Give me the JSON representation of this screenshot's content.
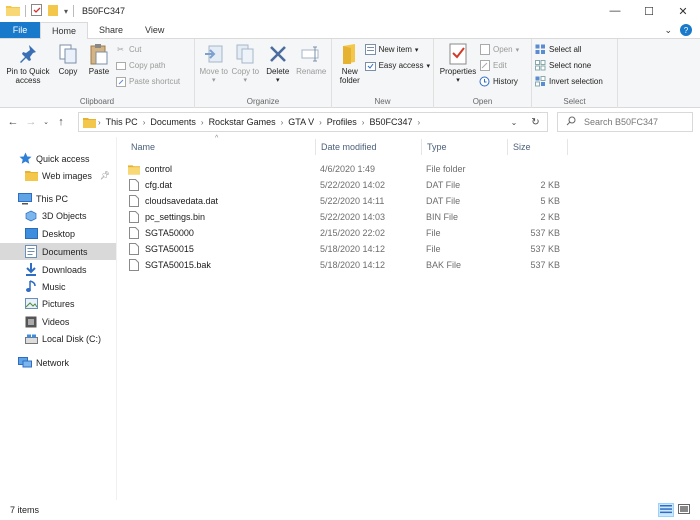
{
  "window": {
    "title": "B50FC347",
    "controls": {
      "minimize": "—",
      "maximize": "☐",
      "close": "✕"
    }
  },
  "tabs": [
    {
      "label": "File"
    },
    {
      "label": "Home"
    },
    {
      "label": "Share"
    },
    {
      "label": "View"
    }
  ],
  "ribbon": {
    "clipboard": {
      "label": "Clipboard",
      "pin_to_quick_access": "Pin to Quick access",
      "copy": "Copy",
      "paste": "Paste",
      "cut": "Cut",
      "copy_path": "Copy path",
      "paste_shortcut": "Paste shortcut"
    },
    "organize": {
      "label": "Organize",
      "move_to": "Move to",
      "copy_to": "Copy to",
      "delete": "Delete",
      "rename": "Rename"
    },
    "new": {
      "label": "New",
      "new_folder": "New folder",
      "new_item": "New item",
      "easy_access": "Easy access"
    },
    "open": {
      "label": "Open",
      "properties": "Properties",
      "open": "Open",
      "edit": "Edit",
      "history": "History"
    },
    "select": {
      "label": "Select",
      "select_all": "Select all",
      "select_none": "Select none",
      "invert_selection": "Invert selection"
    }
  },
  "address": {
    "crumbs": [
      "This PC",
      "Documents",
      "Rockstar Games",
      "GTA V",
      "Profiles",
      "B50FC347"
    ],
    "search_placeholder": "Search B50FC347"
  },
  "nav": {
    "quick_access": "Quick access",
    "web_images": "Web images",
    "this_pc": "This PC",
    "objects_3d": "3D Objects",
    "desktop": "Desktop",
    "documents": "Documents",
    "downloads": "Downloads",
    "music": "Music",
    "pictures": "Pictures",
    "videos": "Videos",
    "local_disk": "Local Disk (C:)",
    "network": "Network"
  },
  "columns": {
    "name": "Name",
    "date_modified": "Date modified",
    "type": "Type",
    "size": "Size"
  },
  "files": [
    {
      "name": "control",
      "date": "4/6/2020 1:49",
      "type": "File folder",
      "size": "",
      "icon": "folder-icon"
    },
    {
      "name": "cfg.dat",
      "date": "5/22/2020 14:02",
      "type": "DAT File",
      "size": "2 KB",
      "icon": "file-icon"
    },
    {
      "name": "cloudsavedata.dat",
      "date": "5/22/2020 14:11",
      "type": "DAT File",
      "size": "5 KB",
      "icon": "file-icon"
    },
    {
      "name": "pc_settings.bin",
      "date": "5/22/2020 14:03",
      "type": "BIN File",
      "size": "2 KB",
      "icon": "file-icon"
    },
    {
      "name": "SGTA50000",
      "date": "2/15/2020 22:02",
      "type": "File",
      "size": "537 KB",
      "icon": "file-icon"
    },
    {
      "name": "SGTA50015",
      "date": "5/18/2020 14:12",
      "type": "File",
      "size": "537 KB",
      "icon": "file-icon"
    },
    {
      "name": "SGTA50015.bak",
      "date": "5/18/2020 14:12",
      "type": "BAK File",
      "size": "537 KB",
      "icon": "file-icon"
    }
  ],
  "status": {
    "item_count": "7 items"
  },
  "colors": {
    "accent": "#1979ca",
    "selected_nav": "#d9d9d9",
    "folder": "#f3c74c",
    "header_text": "#4c607a"
  }
}
